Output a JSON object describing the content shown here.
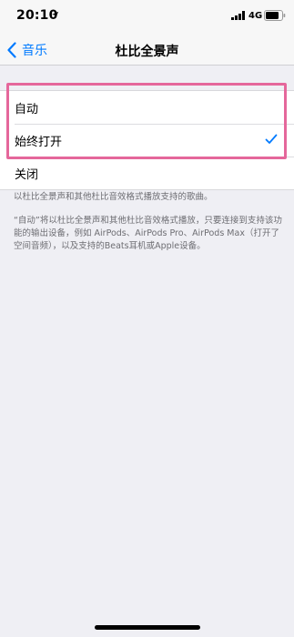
{
  "status_bar": {
    "time": "20:10",
    "network": "4G",
    "icons": [
      "location-arrow-icon",
      "signal-bars-icon",
      "battery-icon"
    ]
  },
  "nav": {
    "back_label": "音乐",
    "title": "杜比全景声",
    "accent_color": "#007aff"
  },
  "options": [
    {
      "label": "自动",
      "checked": false
    },
    {
      "label": "始终打开",
      "checked": true
    },
    {
      "label": "关闭",
      "checked": false
    }
  ],
  "footer": {
    "note_1": "以杜比全景声和其他杜比音效格式播放支持的歌曲。",
    "note_2": "“自动”将以杜比全景声和其他杜比音效格式播放，只要连接到支持该功能的输出设备，例如 AirPods、AirPods Pro、AirPods Max（打开了空间音频），以及支持的Beats耳机或Apple设备。"
  },
  "highlight_color": "#e5679b"
}
